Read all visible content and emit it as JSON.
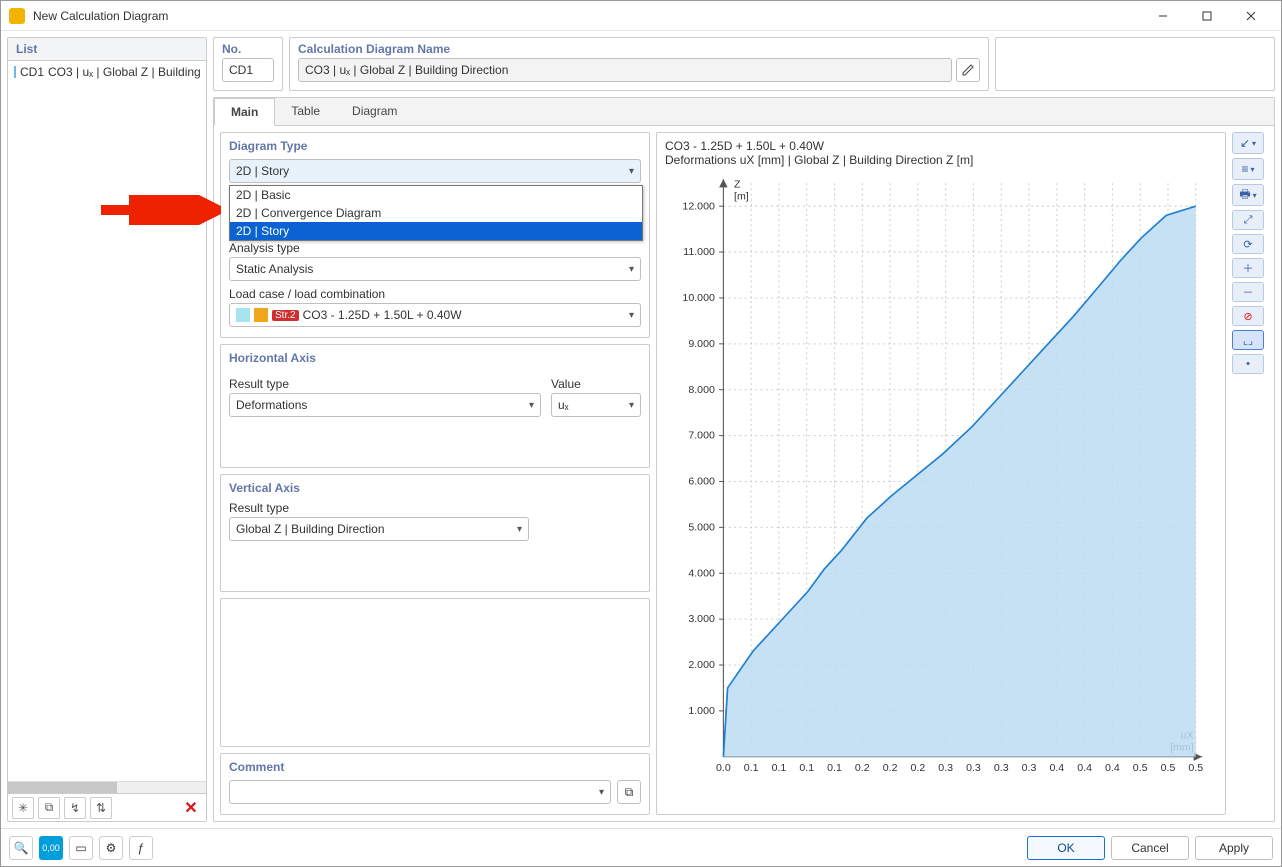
{
  "window": {
    "title": "New Calculation Diagram"
  },
  "left": {
    "header": "List",
    "item_key": "CD1",
    "item_rest": "CO3 | uₓ | Global Z | Building"
  },
  "no_section": {
    "label": "No.",
    "value": "CD1"
  },
  "name_section": {
    "label": "Calculation Diagram Name",
    "value": "CO3 | uₓ | Global Z | Building Direction"
  },
  "tabs": {
    "main": "Main",
    "table": "Table",
    "diagram": "Diagram"
  },
  "diagram_type": {
    "header": "Diagram Type",
    "selected": "2D | Story",
    "options": [
      "2D | Basic",
      "2D | Convergence Diagram",
      "2D | Story"
    ],
    "analysis_type_label": "Analysis type",
    "analysis_type_value": "Static Analysis",
    "loadcase_label": "Load case / load combination",
    "loadcase_tag": "Str.2",
    "loadcase_value": "CO3 - 1.25D + 1.50L + 0.40W"
  },
  "horizontal_axis": {
    "header": "Horizontal Axis",
    "result_type_label": "Result type",
    "result_type_value": "Deformations",
    "value_label": "Value",
    "value_value": "uₓ"
  },
  "vertical_axis": {
    "header": "Vertical Axis",
    "result_type_label": "Result type",
    "result_type_value": "Global Z | Building Direction"
  },
  "comment": {
    "header": "Comment",
    "value": ""
  },
  "chart_header": {
    "line1": "CO3 - 1.25D + 1.50L + 0.40W",
    "line2": "Deformations uX [mm] | Global Z | Building Direction Z [m]"
  },
  "buttons": {
    "ok": "OK",
    "cancel": "Cancel",
    "apply": "Apply"
  },
  "chart_data": {
    "type": "area",
    "title": "CO3 - 1.25D + 1.50L + 0.40W",
    "subtitle": "Deformations uX [mm] | Global Z | Building Direction Z [m]",
    "xlabel": "uX [mm]",
    "ylabel": "Z [m]",
    "xlim": [
      0.0,
      0.56
    ],
    "ylim": [
      0,
      12.5
    ],
    "x_ticks": [
      "0.0",
      "0.1",
      "0.1",
      "0.1",
      "0.1",
      "0.2",
      "0.2",
      "0.2",
      "0.3",
      "0.3",
      "0.3",
      "0.3",
      "0.4",
      "0.4",
      "0.4",
      "0.5",
      "0.5",
      "0.5"
    ],
    "y_ticks": [
      "1.000",
      "2.000",
      "3.000",
      "4.000",
      "5.000",
      "6.000",
      "7.000",
      "8.000",
      "9.000",
      "10.000",
      "11.000",
      "12.000"
    ],
    "series": [
      {
        "name": "uX",
        "points": [
          {
            "x": 0.0,
            "y": 0.0
          },
          {
            "x": 0.005,
            "y": 1.5
          },
          {
            "x": 0.035,
            "y": 2.3
          },
          {
            "x": 0.07,
            "y": 3.0
          },
          {
            "x": 0.1,
            "y": 3.6
          },
          {
            "x": 0.12,
            "y": 4.1
          },
          {
            "x": 0.14,
            "y": 4.5
          },
          {
            "x": 0.17,
            "y": 5.2
          },
          {
            "x": 0.2,
            "y": 5.7
          },
          {
            "x": 0.22,
            "y": 6.0
          },
          {
            "x": 0.26,
            "y": 6.6
          },
          {
            "x": 0.295,
            "y": 7.2
          },
          {
            "x": 0.32,
            "y": 7.7
          },
          {
            "x": 0.355,
            "y": 8.4
          },
          {
            "x": 0.385,
            "y": 9.0
          },
          {
            "x": 0.415,
            "y": 9.6
          },
          {
            "x": 0.445,
            "y": 10.25
          },
          {
            "x": 0.47,
            "y": 10.8
          },
          {
            "x": 0.495,
            "y": 11.3
          },
          {
            "x": 0.525,
            "y": 11.8
          },
          {
            "x": 0.56,
            "y": 12.0
          }
        ]
      }
    ]
  }
}
